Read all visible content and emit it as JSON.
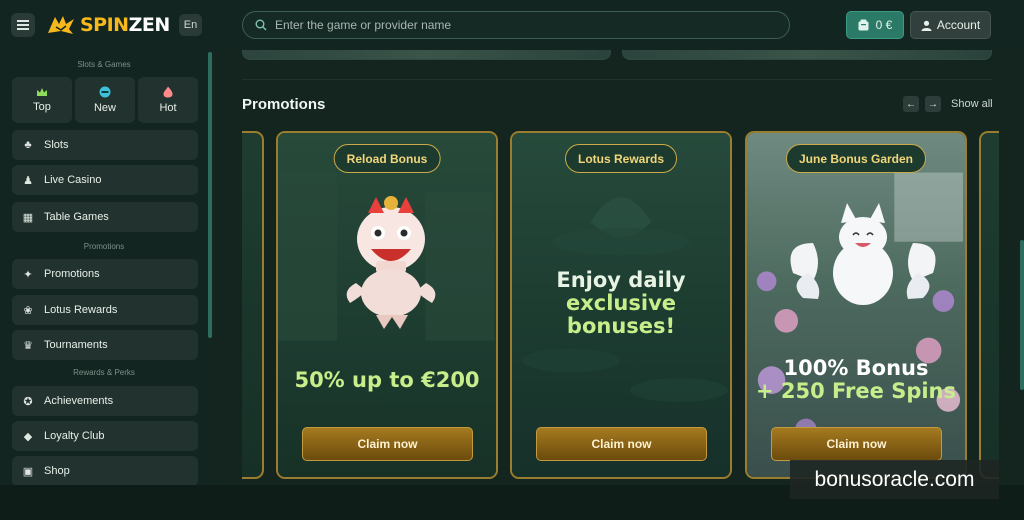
{
  "header": {
    "brand_part1": "SPIN",
    "brand_part2": "ZEN",
    "language": "En",
    "search_placeholder": "Enter the game or provider name",
    "balance": "0 €",
    "account_label": "Account"
  },
  "sidebar": {
    "section_slots": "Slots & Games",
    "quick": [
      {
        "label": "Top",
        "icon": "crown-icon",
        "color": "#8fdc5a"
      },
      {
        "label": "New",
        "icon": "new-badge-icon",
        "color": "#3fc1d9"
      },
      {
        "label": "Hot",
        "icon": "flame-icon",
        "color": "#ff8a8a"
      }
    ],
    "games": [
      {
        "label": "Slots",
        "icon": "cherries-icon"
      },
      {
        "label": "Live Casino",
        "icon": "dealer-icon"
      },
      {
        "label": "Table Games",
        "icon": "table-icon"
      }
    ],
    "section_promotions": "Promotions",
    "promotions": [
      {
        "label": "Promotions",
        "icon": "gift-icon"
      },
      {
        "label": "Lotus Rewards",
        "icon": "lotus-icon"
      },
      {
        "label": "Tournaments",
        "icon": "trophy-icon"
      }
    ],
    "section_rewards": "Rewards & Perks",
    "rewards": [
      {
        "label": "Achievements",
        "icon": "medal-icon"
      },
      {
        "label": "Loyalty Club",
        "icon": "diamond-icon"
      },
      {
        "label": "Shop",
        "icon": "shop-icon"
      }
    ]
  },
  "main": {
    "promotions_title": "Promotions",
    "show_all": "Show all",
    "cards": [
      {
        "badge": "Reload Bonus",
        "headline": "50% up to €200",
        "button": "Claim now"
      },
      {
        "badge": "Lotus Rewards",
        "headline_line1": "Enjoy daily",
        "headline_line2": "exclusive",
        "headline_line3": "bonuses!",
        "button": "Claim now"
      },
      {
        "badge": "June Bonus Garden",
        "headline_line1": "100% Bonus",
        "headline_line2": "+ 250 Free Spins",
        "button": "Claim now"
      }
    ]
  },
  "watermark": "bonusoracle.com",
  "colors": {
    "accent_gold": "#f6b81c",
    "accent_teal": "#2a7a67",
    "headline_green": "#c8ee8c"
  }
}
